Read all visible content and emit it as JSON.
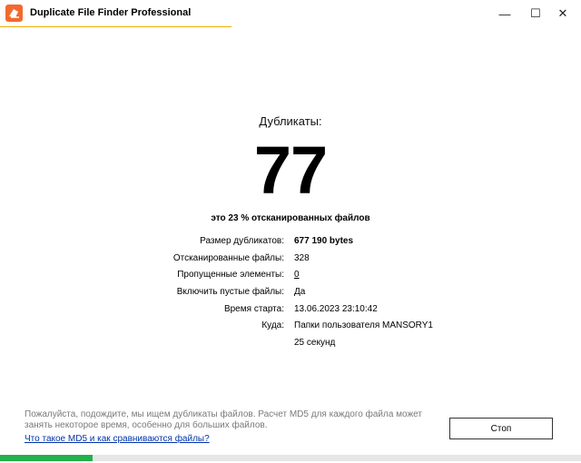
{
  "window": {
    "title": "Duplicate File Finder Professional",
    "minimize_glyph": "—",
    "maximize_glyph": "☐",
    "close_glyph": "✕"
  },
  "summary": {
    "duplicates_label": "Дубликаты:",
    "duplicates_count": "77",
    "percent_text": "это 23 % отсканированных файлов"
  },
  "stats": [
    {
      "label": "Размер дубликатов:",
      "value": "677 190 bytes"
    },
    {
      "label": "Отсканированные файлы:",
      "value": "328"
    },
    {
      "label": "Пропущенные элементы:",
      "value": "0"
    },
    {
      "label": "Включить пустые файлы:",
      "value": "Да"
    },
    {
      "label": "Время старта:",
      "value": "13.06.2023 23:10:42"
    },
    {
      "label": "Куда:",
      "value": "Папки пользователя MANSORY1"
    },
    {
      "label": "",
      "value": "25 секунд"
    }
  ],
  "footer": {
    "info_text": "Пожалуйста, подождите, мы ищем дубликаты файлов. Расчет MD5 для каждого файла может занять некоторое время, особенно для больших файлов.",
    "md5_link": "Что такое MD5 и как сравниваются файлы?",
    "stop_label": "Стоп"
  },
  "progress": {
    "fraction": 0.16,
    "color": "#22b14c"
  },
  "colors": {
    "accent": "#f26a2e",
    "title_accent": "#f0b000",
    "link": "#0033aa"
  },
  "icons": {
    "app": "app-logo-icon"
  }
}
